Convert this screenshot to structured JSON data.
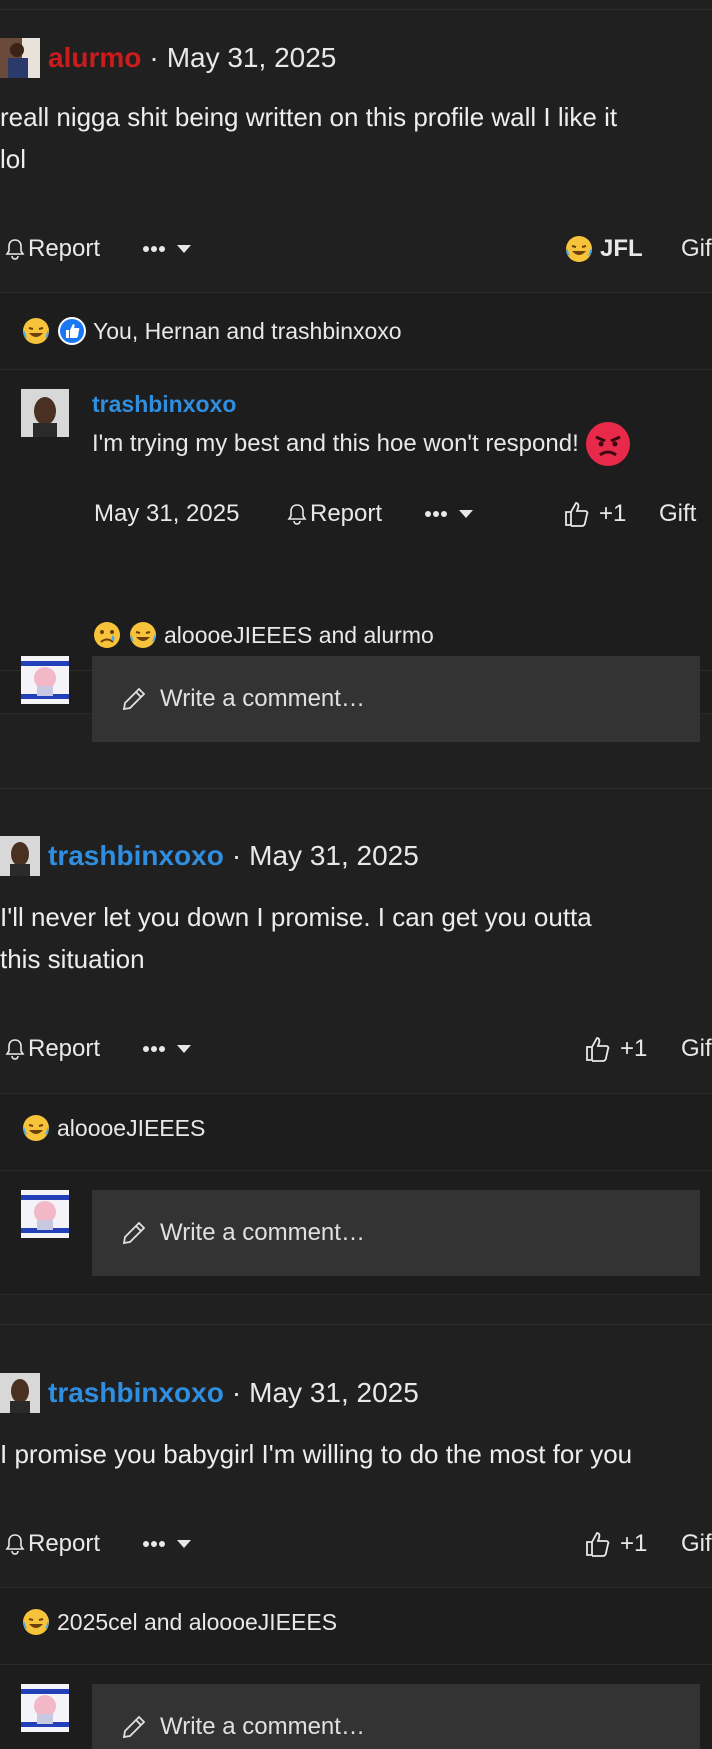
{
  "posts": [
    {
      "author": "alurmo",
      "date": "May 31, 2025",
      "text_line1": "reall nigga shit being written on this profile wall I like it",
      "text_line2": "lol",
      "report_label": "Report",
      "reaction_label": "JFL",
      "gift_label": "Gif",
      "reactions_text": "You, Hernan and trashbinxoxo",
      "reply": {
        "author": "trashbinxoxo",
        "text": "I'm trying my best and this hoe won't respond!",
        "date": "May 31, 2025",
        "report_label": "Report",
        "like_label": "+1",
        "gift_label": "Gift",
        "reactions_text": "aloooeJIEEES and alurmo"
      },
      "comment_placeholder": "Write a comment…"
    },
    {
      "author": "trashbinxoxo",
      "date": "May 31, 2025",
      "text_line1": "I'll never let you down I promise. I can get you outta",
      "text_line2": "this situation",
      "report_label": "Report",
      "like_label": "+1",
      "gift_label": "Gif",
      "reactions_text": "aloooeJIEEES",
      "comment_placeholder": "Write a comment…"
    },
    {
      "author": "trashbinxoxo",
      "date": "May 31, 2025",
      "text_line1": "I promise you babygirl I'm willing to do the most for you",
      "report_label": "Report",
      "like_label": "+1",
      "gift_label": "Gif",
      "reactions_text": "2025cel and aloooeJIEEES",
      "comment_placeholder": "Write a comment…"
    }
  ],
  "separator_dot": "·",
  "colors": {
    "background": "#202020",
    "link_blue": "#2f8ee0",
    "author_red": "#cc1b1b",
    "input_bg": "#333333"
  }
}
